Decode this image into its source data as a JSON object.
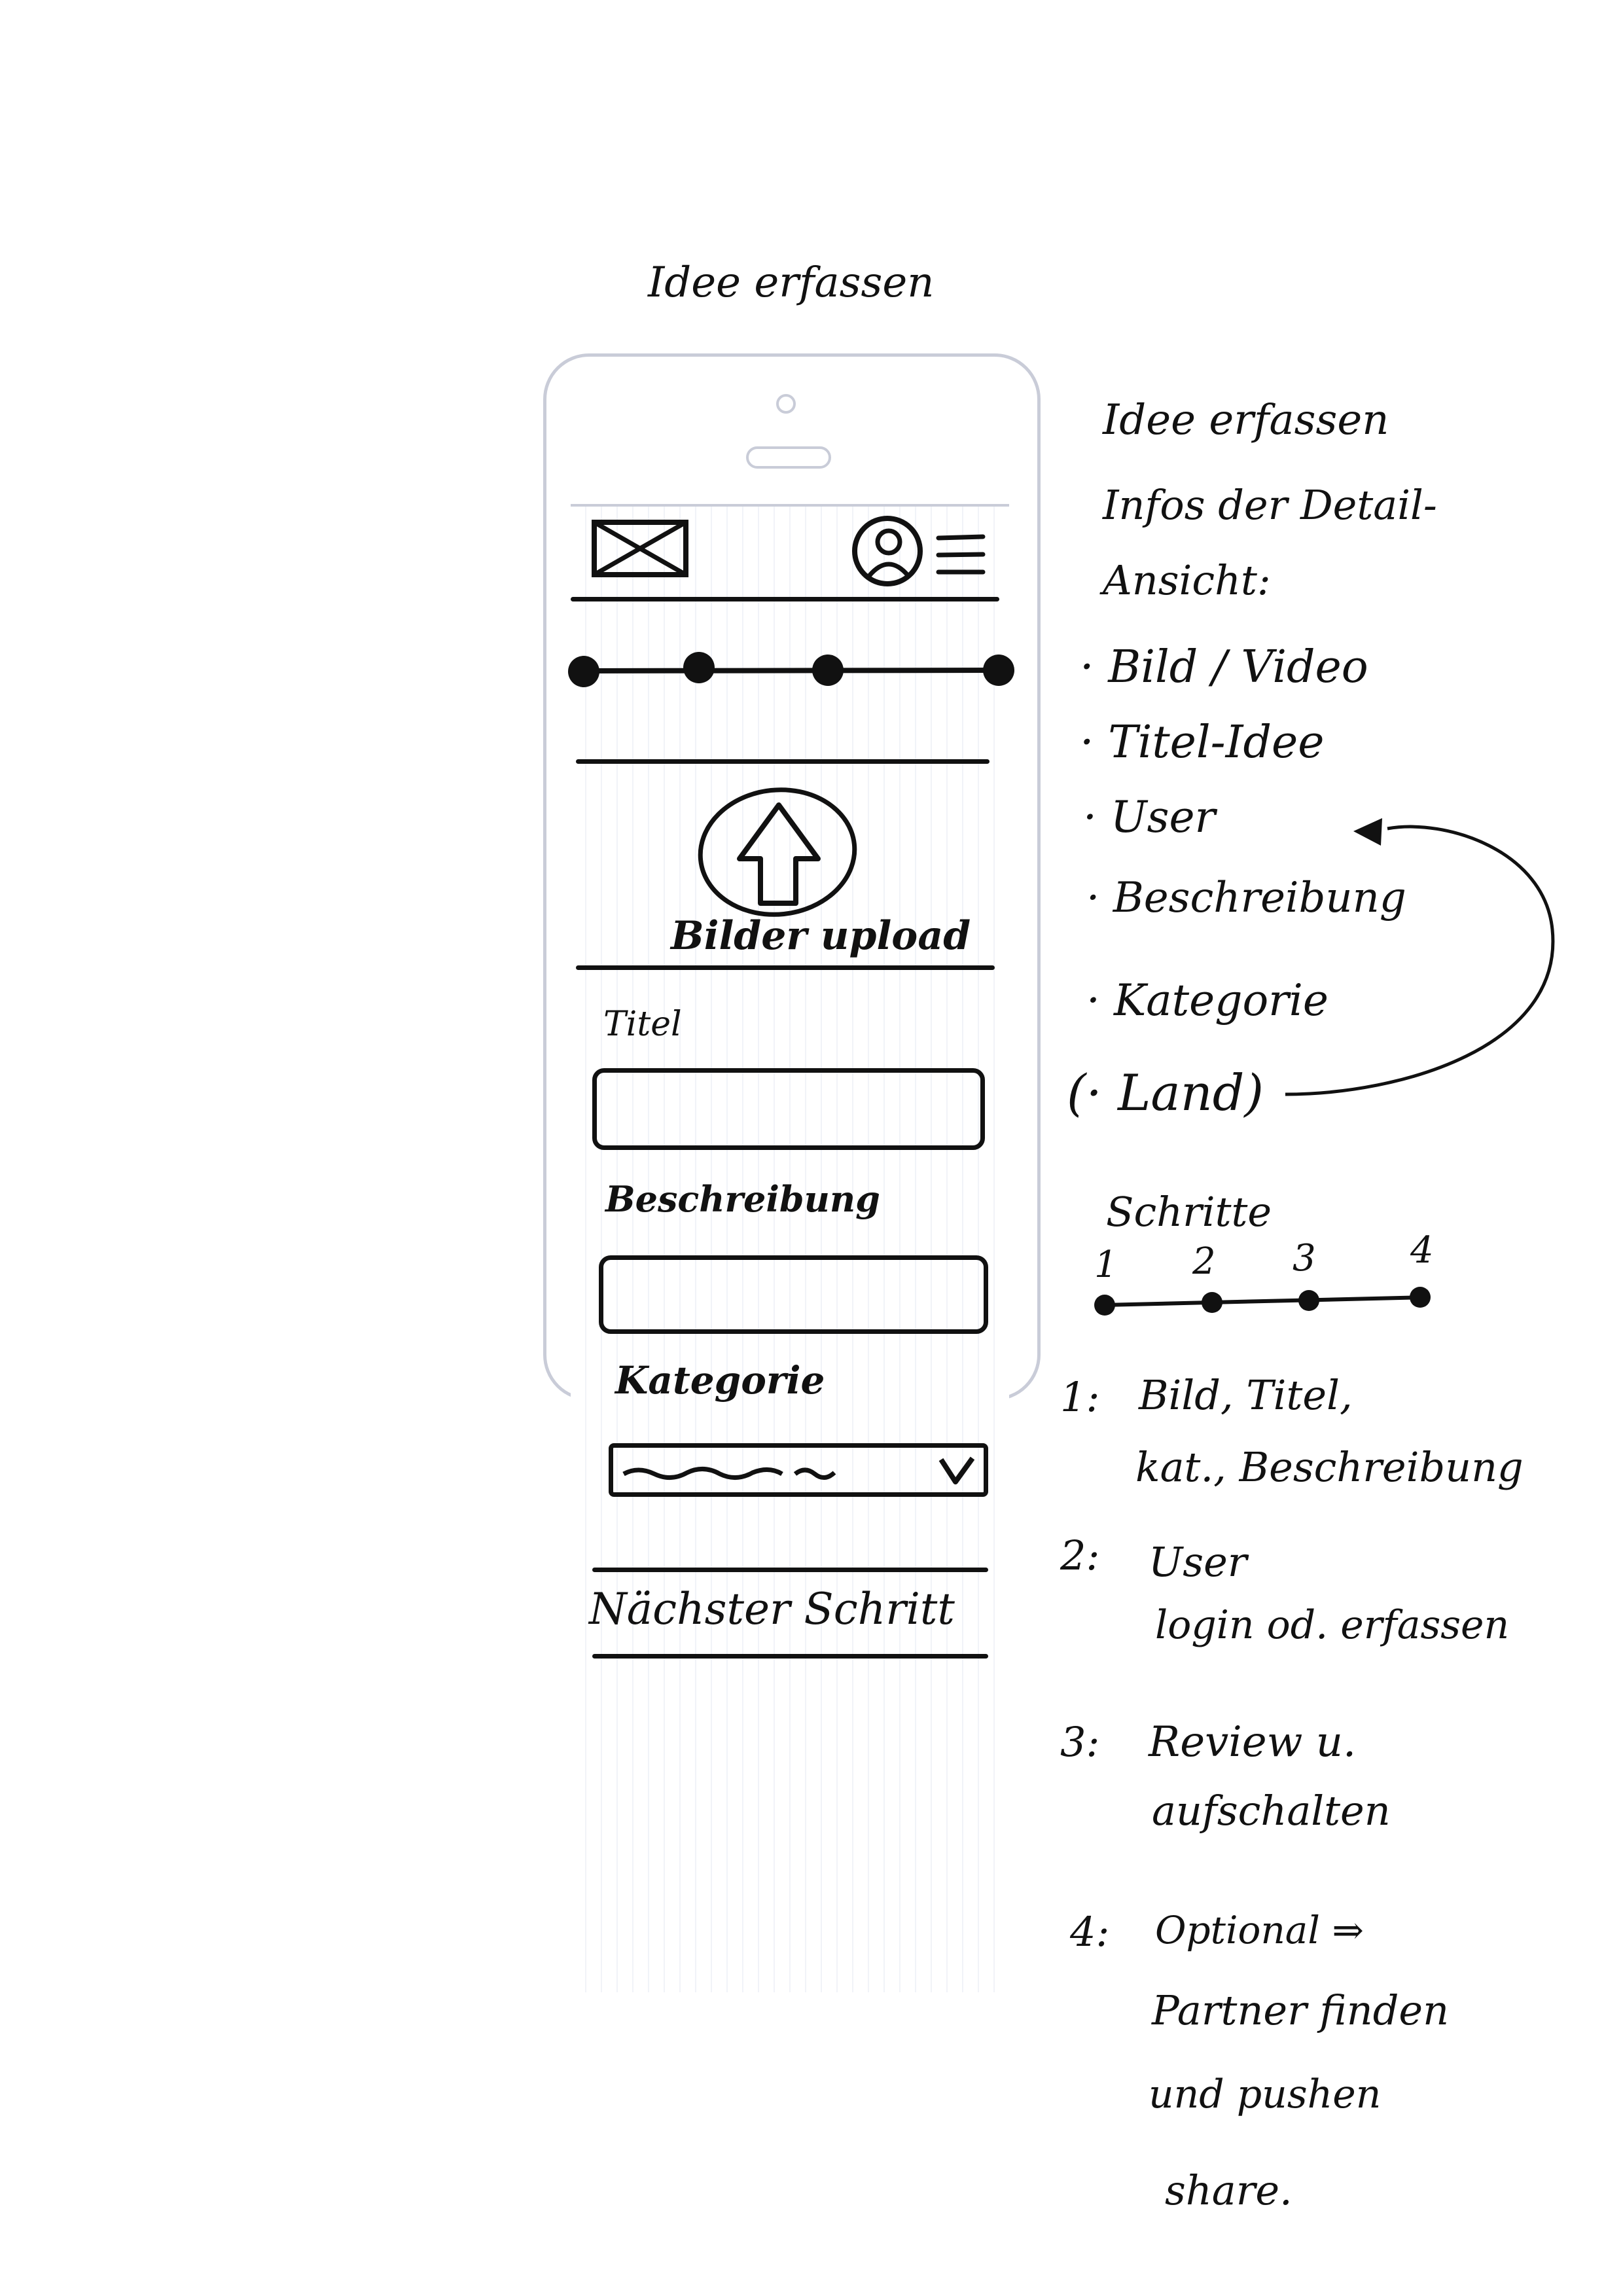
{
  "sketch_title": "Idee erfassen",
  "phone": {
    "upload_label": "Bilder upload",
    "title_label": "Titel",
    "description_label": "Beschreibung",
    "category_label": "Kategorie",
    "next_button": "Nächster Schritt"
  },
  "notes": {
    "heading_1": "Idee erfassen",
    "heading_2": "Infos der Detail-",
    "heading_3": "Ansicht:",
    "items": [
      "· Bild / Video",
      "· Titel-Idee",
      "· User",
      "· Beschreibung",
      "· Kategorie",
      "(· Land)"
    ],
    "steps_title": "Schritte",
    "step_numbers": [
      "1",
      "2",
      "3",
      "4"
    ],
    "step_1_num": "1:",
    "step_1_line1": "Bild, Titel,",
    "step_1_line2": "kat., Beschreibung",
    "step_2_num": "2:",
    "step_2_line1": "User",
    "step_2_line2": "login od. erfassen",
    "step_3_num": "3:",
    "step_3_line1": "Review u.",
    "step_3_line2": "aufschalten",
    "step_4_num": "4:",
    "step_4_line1": "Optional ⇒",
    "step_4_line2": "Partner finden",
    "step_4_line3": "und pushen",
    "step_4_line4": "share."
  },
  "icons": [
    "image-placeholder-icon",
    "user-icon",
    "menu-icon",
    "upload-arrow-icon",
    "chevron-down-icon",
    "curved-arrow-icon"
  ]
}
